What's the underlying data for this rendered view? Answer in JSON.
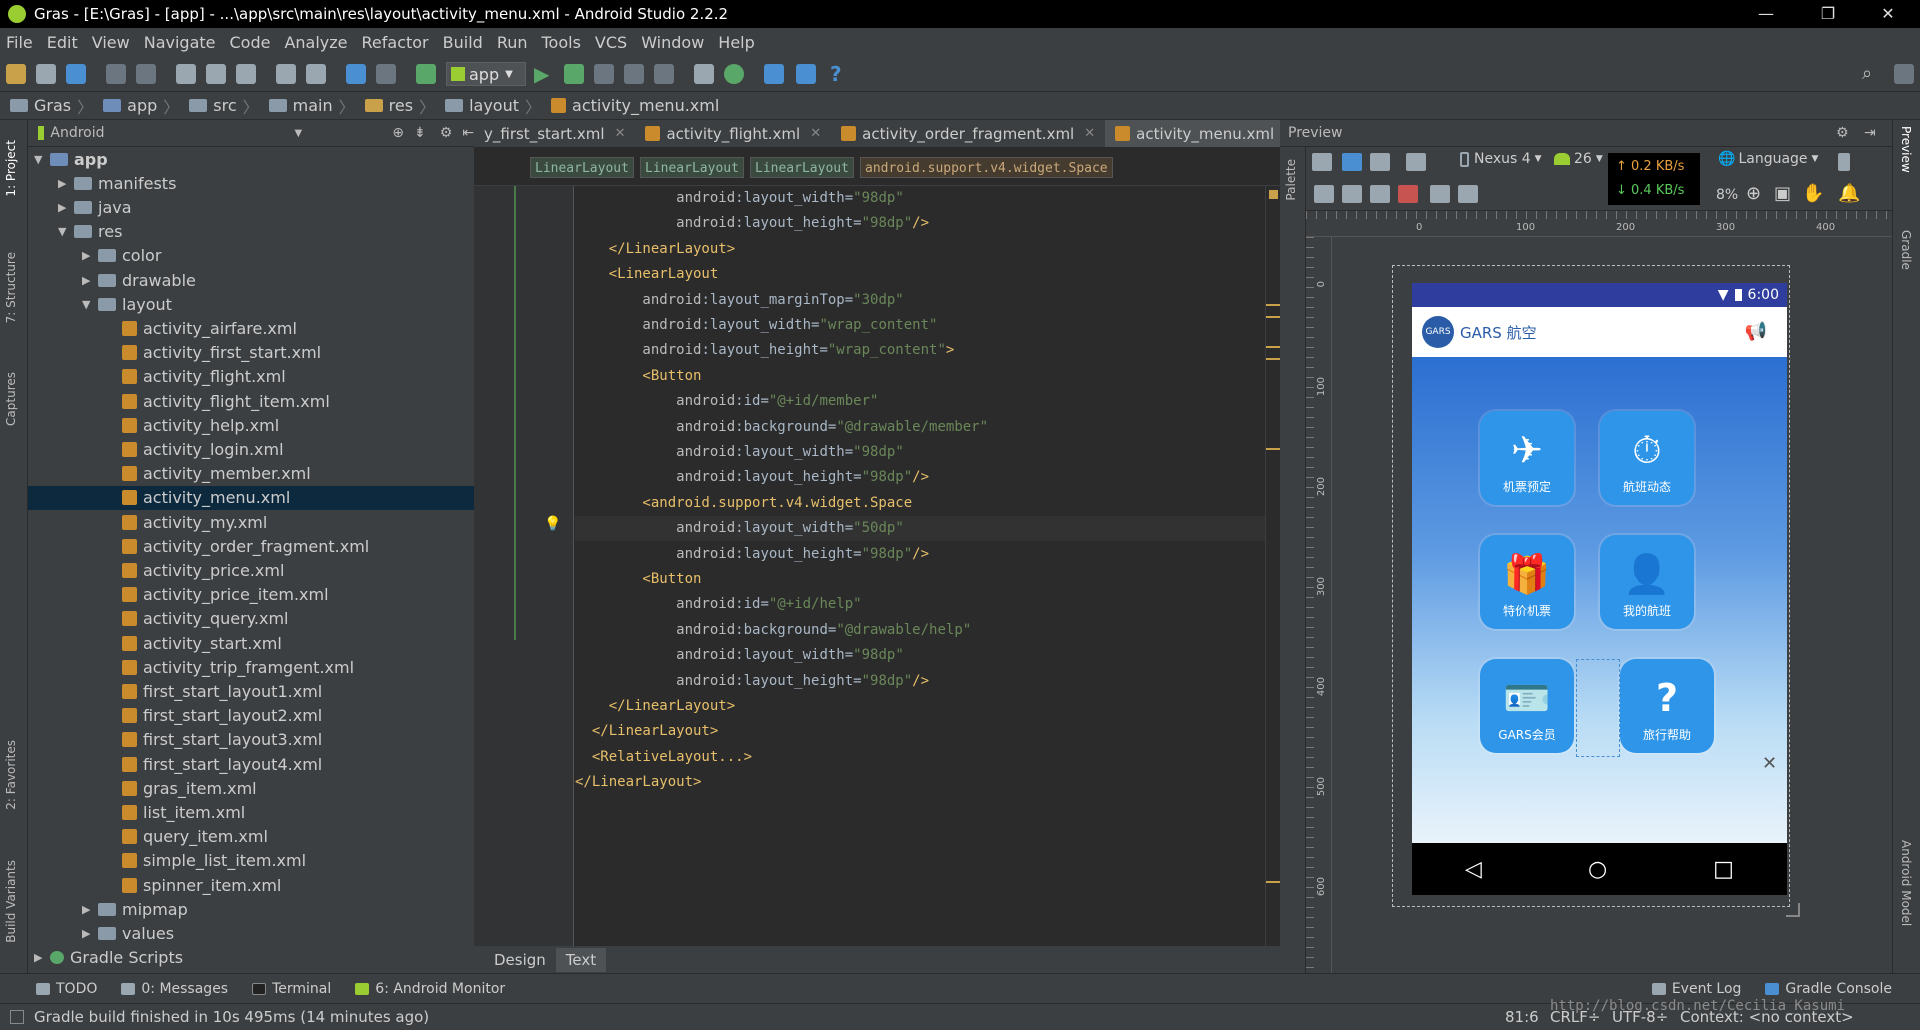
{
  "window": {
    "title": "Gras - [E:\\Gras] - [app] - ...\\app\\src\\main\\res\\layout\\activity_menu.xml - Android Studio 2.2.2"
  },
  "menu": [
    "File",
    "Edit",
    "View",
    "Navigate",
    "Code",
    "Analyze",
    "Refactor",
    "Build",
    "Run",
    "Tools",
    "VCS",
    "Window",
    "Help"
  ],
  "toolbar": {
    "run_config": "app"
  },
  "breadcrumb": [
    "Gras",
    "app",
    "src",
    "main",
    "res",
    "layout",
    "activity_menu.xml"
  ],
  "project": {
    "view_mode": "Android",
    "tree": [
      {
        "label": "app",
        "level": 0,
        "arrow": "▼",
        "kind": "module"
      },
      {
        "label": "manifests",
        "level": 1,
        "arrow": "▶",
        "kind": "folder"
      },
      {
        "label": "java",
        "level": 1,
        "arrow": "▶",
        "kind": "folder"
      },
      {
        "label": "res",
        "level": 1,
        "arrow": "▼",
        "kind": "folder"
      },
      {
        "label": "color",
        "level": 2,
        "arrow": "▶",
        "kind": "folder"
      },
      {
        "label": "drawable",
        "level": 2,
        "arrow": "▶",
        "kind": "folder"
      },
      {
        "label": "layout",
        "level": 2,
        "arrow": "▼",
        "kind": "folder"
      },
      {
        "label": "activity_airfare.xml",
        "level": 3,
        "kind": "xml"
      },
      {
        "label": "activity_first_start.xml",
        "level": 3,
        "kind": "xml"
      },
      {
        "label": "activity_flight.xml",
        "level": 3,
        "kind": "xml"
      },
      {
        "label": "activity_flight_item.xml",
        "level": 3,
        "kind": "xml"
      },
      {
        "label": "activity_help.xml",
        "level": 3,
        "kind": "xml"
      },
      {
        "label": "activity_login.xml",
        "level": 3,
        "kind": "xml"
      },
      {
        "label": "activity_member.xml",
        "level": 3,
        "kind": "xml"
      },
      {
        "label": "activity_menu.xml",
        "level": 3,
        "kind": "xml",
        "selected": true
      },
      {
        "label": "activity_my.xml",
        "level": 3,
        "kind": "xml"
      },
      {
        "label": "activity_order_fragment.xml",
        "level": 3,
        "kind": "xml"
      },
      {
        "label": "activity_price.xml",
        "level": 3,
        "kind": "xml"
      },
      {
        "label": "activity_price_item.xml",
        "level": 3,
        "kind": "xml"
      },
      {
        "label": "activity_query.xml",
        "level": 3,
        "kind": "xml"
      },
      {
        "label": "activity_start.xml",
        "level": 3,
        "kind": "xml"
      },
      {
        "label": "activity_trip_framgent.xml",
        "level": 3,
        "kind": "xml"
      },
      {
        "label": "first_start_layout1.xml",
        "level": 3,
        "kind": "xml"
      },
      {
        "label": "first_start_layout2.xml",
        "level": 3,
        "kind": "xml"
      },
      {
        "label": "first_start_layout3.xml",
        "level": 3,
        "kind": "xml"
      },
      {
        "label": "first_start_layout4.xml",
        "level": 3,
        "kind": "xml"
      },
      {
        "label": "gras_item.xml",
        "level": 3,
        "kind": "xml"
      },
      {
        "label": "list_item.xml",
        "level": 3,
        "kind": "xml"
      },
      {
        "label": "query_item.xml",
        "level": 3,
        "kind": "xml"
      },
      {
        "label": "simple_list_item.xml",
        "level": 3,
        "kind": "xml"
      },
      {
        "label": "spinner_item.xml",
        "level": 3,
        "kind": "xml"
      },
      {
        "label": "mipmap",
        "level": 2,
        "arrow": "▶",
        "kind": "folder"
      },
      {
        "label": "values",
        "level": 2,
        "arrow": "▶",
        "kind": "folder"
      },
      {
        "label": "Gradle Scripts",
        "level": 0,
        "arrow": "▶",
        "kind": "gradle"
      }
    ]
  },
  "editor_tabs": [
    {
      "label": "y_first_start.xml",
      "active": false
    },
    {
      "label": "activity_flight.xml",
      "active": false
    },
    {
      "label": "activity_order_fragment.xml",
      "active": false
    },
    {
      "label": "activity_menu.xml",
      "active": true
    }
  ],
  "editor_tabs_more": "≡",
  "tag_path": [
    "LinearLayout",
    "LinearLayout",
    "LinearLayout",
    "android.support.v4.widget.Space"
  ],
  "code_lines": [
    [
      {
        "c": "a",
        "t": "            android"
      },
      {
        "c": "x",
        "t": ":layout_width="
      },
      {
        "c": "s",
        "t": "\"98dp\""
      }
    ],
    [
      {
        "c": "a",
        "t": "            android"
      },
      {
        "c": "x",
        "t": ":layout_height="
      },
      {
        "c": "s",
        "t": "\"98dp\""
      },
      {
        "c": "t",
        "t": "/>"
      }
    ],
    [
      {
        "c": "t",
        "t": "    </LinearLayout>"
      }
    ],
    [
      {
        "c": "t",
        "t": "    <LinearLayout"
      }
    ],
    [
      {
        "c": "a",
        "t": "        android"
      },
      {
        "c": "x",
        "t": ":layout_marginTop="
      },
      {
        "c": "s",
        "t": "\"30dp\""
      }
    ],
    [
      {
        "c": "a",
        "t": "        android"
      },
      {
        "c": "x",
        "t": ":layout_width="
      },
      {
        "c": "s",
        "t": "\"wrap_content\""
      }
    ],
    [
      {
        "c": "a",
        "t": "        android"
      },
      {
        "c": "x",
        "t": ":layout_height="
      },
      {
        "c": "s",
        "t": "\"wrap_content\""
      },
      {
        "c": "t",
        "t": ">"
      }
    ],
    [
      {
        "c": "t",
        "t": "        <Button"
      }
    ],
    [
      {
        "c": "a",
        "t": "            android"
      },
      {
        "c": "x",
        "t": ":id="
      },
      {
        "c": "s",
        "t": "\"@+id/member\""
      }
    ],
    [
      {
        "c": "a",
        "t": "            android"
      },
      {
        "c": "x",
        "t": ":background="
      },
      {
        "c": "s",
        "t": "\"@drawable/member\""
      }
    ],
    [
      {
        "c": "a",
        "t": "            android"
      },
      {
        "c": "x",
        "t": ":layout_width="
      },
      {
        "c": "s",
        "t": "\"98dp\""
      }
    ],
    [
      {
        "c": "a",
        "t": "            android"
      },
      {
        "c": "x",
        "t": ":layout_height="
      },
      {
        "c": "s",
        "t": "\"98dp\""
      },
      {
        "c": "t",
        "t": "/>"
      }
    ],
    [
      {
        "c": "t",
        "t": "        <android.support.v4.widget.Space"
      }
    ],
    [
      {
        "c": "a",
        "t": "            android"
      },
      {
        "c": "x",
        "t": ":layout_width="
      },
      {
        "c": "s",
        "t": "\"50dp\""
      }
    ],
    [
      {
        "c": "a",
        "t": "            android"
      },
      {
        "c": "x",
        "t": ":layout_height="
      },
      {
        "c": "s",
        "t": "\"98dp\""
      },
      {
        "c": "t",
        "t": "/>"
      }
    ],
    [
      {
        "c": "t",
        "t": "        <Button"
      }
    ],
    [
      {
        "c": "a",
        "t": "            android"
      },
      {
        "c": "x",
        "t": ":id="
      },
      {
        "c": "s",
        "t": "\"@+id/help\""
      }
    ],
    [
      {
        "c": "a",
        "t": "            android"
      },
      {
        "c": "x",
        "t": ":background="
      },
      {
        "c": "s",
        "t": "\"@drawable/help\""
      }
    ],
    [
      {
        "c": "a",
        "t": "            android"
      },
      {
        "c": "x",
        "t": ":layout_width="
      },
      {
        "c": "s",
        "t": "\"98dp\""
      }
    ],
    [
      {
        "c": "a",
        "t": "            android"
      },
      {
        "c": "x",
        "t": ":layout_height="
      },
      {
        "c": "s",
        "t": "\"98dp\""
      },
      {
        "c": "t",
        "t": "/>"
      }
    ],
    [
      {
        "c": "t",
        "t": "    </LinearLayout>"
      }
    ],
    [
      {
        "c": "t",
        "t": "  </LinearLayout>"
      }
    ],
    [
      {
        "c": "t",
        "t": "  <RelativeLayout...>"
      }
    ],
    [
      {
        "c": "t",
        "t": "</LinearLayout>"
      }
    ]
  ],
  "design_tabs": [
    {
      "label": "Design",
      "active": false
    },
    {
      "label": "Text",
      "active": true
    }
  ],
  "preview": {
    "title": "Preview",
    "device": "Nexus 4",
    "api": "26",
    "language": "Language",
    "zoom": "8%",
    "net_up": "↑ 0.2 KB/s",
    "net_down": "↓ 0.4 KB/s",
    "ruler_h": [
      "0",
      "100",
      "200",
      "300",
      "400"
    ],
    "ruler_v": [
      "0",
      "100",
      "200",
      "300",
      "400",
      "500",
      "600"
    ]
  },
  "phone": {
    "time": "6:00",
    "logo_text": "GARS",
    "app_title": "GARS  航空",
    "tiles": [
      {
        "label": "机票预定",
        "icon": "✈"
      },
      {
        "label": "航班动态",
        "icon": "⏱"
      },
      {
        "label": "特价机票",
        "icon": "🎁"
      },
      {
        "label": "我的航班",
        "icon": "👤"
      },
      {
        "label": "GARS会员",
        "icon": "🪪"
      },
      {
        "label": "旅行帮助",
        "icon": "?"
      }
    ],
    "nav_back": "◁",
    "nav_home": "○",
    "nav_recent": "□",
    "close": "✕"
  },
  "side_tabs_left": [
    "1: Project",
    "7: Structure",
    "Captures",
    "2: Favorites",
    "Build Variants"
  ],
  "side_tabs_right": [
    "Preview",
    "Gradle",
    "Android Model"
  ],
  "palette_label": "Palette",
  "bottom_tabs": [
    "TODO",
    "0: Messages",
    "Terminal",
    "6: Android Monitor"
  ],
  "bottom_tabs_right": [
    "Event Log",
    "Gradle Console"
  ],
  "status": {
    "message": "Gradle build finished in 10s 495ms (14 minutes ago)",
    "position": "81:6",
    "line_sep": "CRLF÷",
    "encoding": "UTF-8÷",
    "context": "Context: <no context>"
  },
  "watermark": "http://blog.csdn.net/Cecilia_Kasumi",
  "colors": {
    "accent": "#2f95e8",
    "selection": "#0d293e",
    "tag": "#e8bf6a",
    "string": "#6a8759"
  }
}
